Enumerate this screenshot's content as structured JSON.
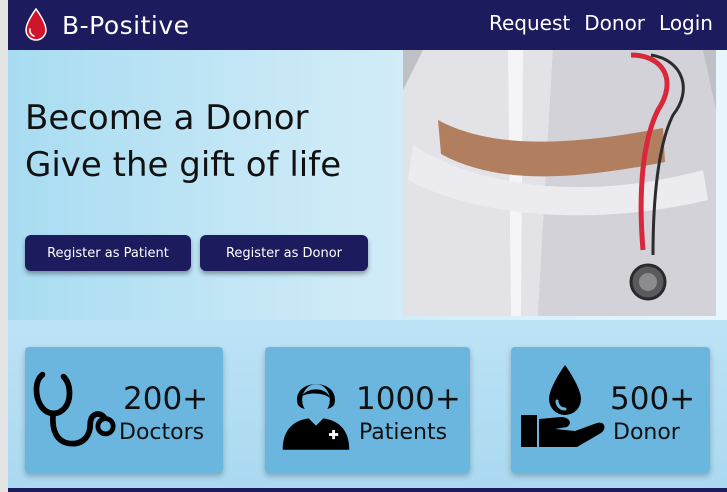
{
  "navbar": {
    "brand": "B-Positive",
    "links": [
      "Request",
      "Donor",
      "Login"
    ]
  },
  "hero": {
    "title_line1": "Become a Donor",
    "title_line2": "Give the gift of life",
    "buttons": {
      "patient": "Register as Patient",
      "donor": "Register as Donor"
    }
  },
  "stats": [
    {
      "value": "200+",
      "label": "Doctors",
      "icon": "stethoscope-icon"
    },
    {
      "value": "1000+",
      "label": "Patients",
      "icon": "patient-icon"
    },
    {
      "value": "500+",
      "label": "Donor",
      "icon": "donation-hand-icon"
    }
  ],
  "colors": {
    "primary": "#1c1b5e",
    "card": "#6ab6df",
    "blood": "#d2142a"
  }
}
